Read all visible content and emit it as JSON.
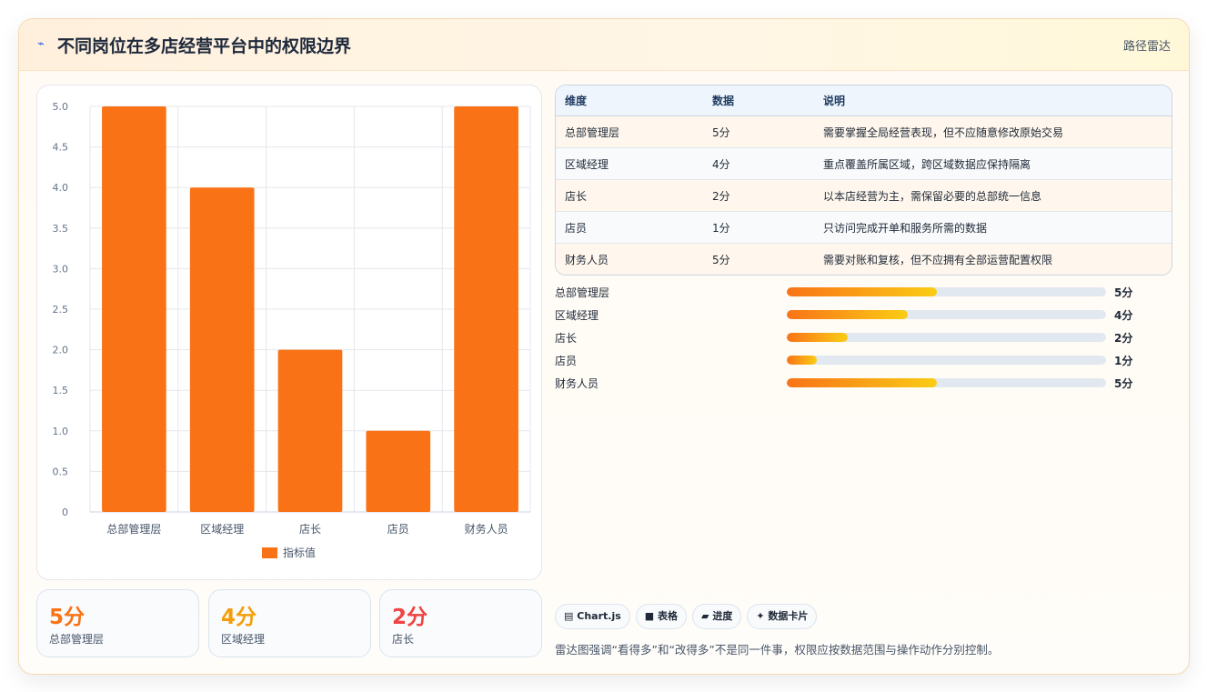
{
  "header": {
    "icon": "chart-line-icon",
    "title": "不同岗位在多店经营平台中的权限边界",
    "badge": "路径雷达"
  },
  "chart_data": {
    "type": "bar",
    "categories": [
      "总部管理层",
      "区域经理",
      "店长",
      "店员",
      "财务人员"
    ],
    "series": [
      {
        "name": "指标值",
        "values": [
          5,
          4,
          2,
          1,
          5
        ],
        "color": "#f97316"
      }
    ],
    "ylim": [
      0,
      5
    ],
    "yticks": [
      "0",
      "0.5",
      "1.0",
      "1.5",
      "2.0",
      "2.5",
      "3.0",
      "3.5",
      "4.0",
      "4.5",
      "5.0"
    ],
    "grid": true,
    "legend": "bottom"
  },
  "stats": [
    {
      "value": "5分",
      "label": "总部管理层",
      "color": "#f97316"
    },
    {
      "value": "4分",
      "label": "区域经理",
      "color": "#f59e0b"
    },
    {
      "value": "2分",
      "label": "店长",
      "color": "#ef4444"
    }
  ],
  "table": {
    "headers": [
      "维度",
      "数据",
      "说明"
    ],
    "rows": [
      [
        "总部管理层",
        "5分",
        "需要掌握全局经营表现，但不应随意修改原始交易"
      ],
      [
        "区域经理",
        "4分",
        "重点覆盖所属区域，跨区域数据应保持隔离"
      ],
      [
        "店长",
        "2分",
        "以本店经营为主，需保留必要的总部统一信息"
      ],
      [
        "店员",
        "1分",
        "只访问完成开单和服务所需的数据"
      ],
      [
        "财务人员",
        "5分",
        "需要对账和复核，但不应拥有全部运营配置权限"
      ]
    ]
  },
  "progress": [
    {
      "label": "总部管理层",
      "value": "5分",
      "fraction": 0.47
    },
    {
      "label": "区域经理",
      "value": "4分",
      "fraction": 0.38
    },
    {
      "label": "店长",
      "value": "2分",
      "fraction": 0.19
    },
    {
      "label": "店员",
      "value": "1分",
      "fraction": 0.095
    },
    {
      "label": "财务人员",
      "value": "5分",
      "fraction": 0.47
    }
  ],
  "chips": [
    {
      "icon": "chart-icon",
      "glyph": "▤",
      "label": "Chart.js"
    },
    {
      "icon": "table-icon",
      "glyph": "■",
      "label": "表格"
    },
    {
      "icon": "progress-icon",
      "glyph": "▰",
      "label": "进度"
    },
    {
      "icon": "sparkle-icon",
      "glyph": "✦",
      "label": "数据卡片"
    }
  ],
  "note": "雷达图强调“看得多”和“改得多”不是同一件事，权限应按数据范围与操作动作分别控制。"
}
